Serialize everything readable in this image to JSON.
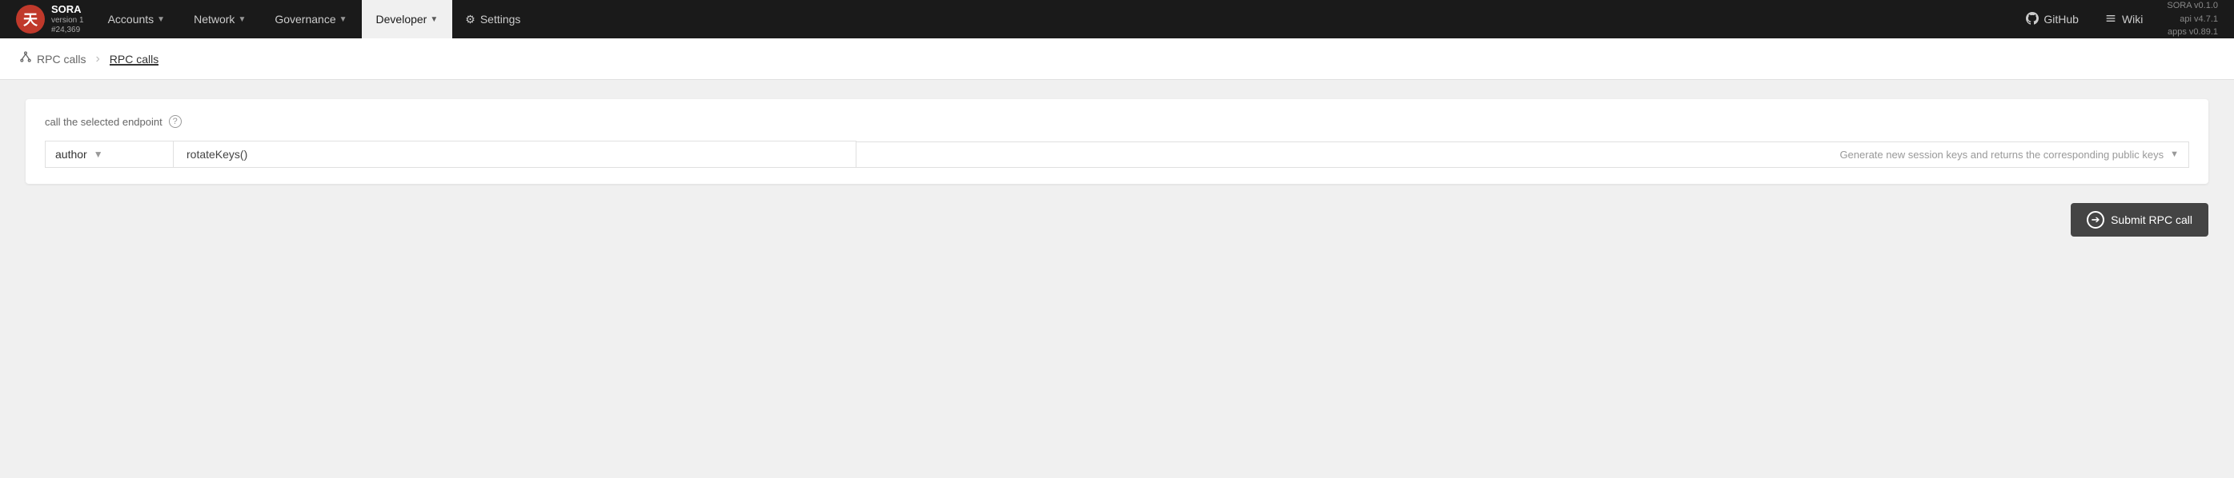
{
  "brand": {
    "logo_char": "天",
    "name": "SORA",
    "version": "version 1",
    "block": "#24,369"
  },
  "navbar": {
    "items": [
      {
        "id": "accounts",
        "label": "Accounts",
        "has_dropdown": true
      },
      {
        "id": "network",
        "label": "Network",
        "has_dropdown": true
      },
      {
        "id": "governance",
        "label": "Governance",
        "has_dropdown": true
      },
      {
        "id": "developer",
        "label": "Developer",
        "has_dropdown": true,
        "active": true
      },
      {
        "id": "settings",
        "label": "Settings",
        "has_dropdown": false,
        "is_settings": true
      }
    ],
    "right_items": [
      {
        "id": "github",
        "label": "GitHub",
        "icon": "git-icon"
      },
      {
        "id": "wiki",
        "label": "Wiki",
        "icon": "wiki-icon"
      }
    ]
  },
  "version_info": {
    "sora": "SORA v0.1.0",
    "api": "api v4.7.1",
    "apps": "apps v0.89.1"
  },
  "breadcrumb": {
    "parent_icon": "network-icon",
    "parent_label": "RPC calls",
    "active_label": "RPC calls"
  },
  "rpc_panel": {
    "header": "call the selected endpoint",
    "help_tooltip": "?",
    "endpoint_select": {
      "value": "author",
      "placeholder": "author"
    },
    "method_select": {
      "value": "rotateKeys()"
    },
    "description": "Generate new session keys and returns the corresponding public keys",
    "submit_label": "Submit RPC call"
  }
}
